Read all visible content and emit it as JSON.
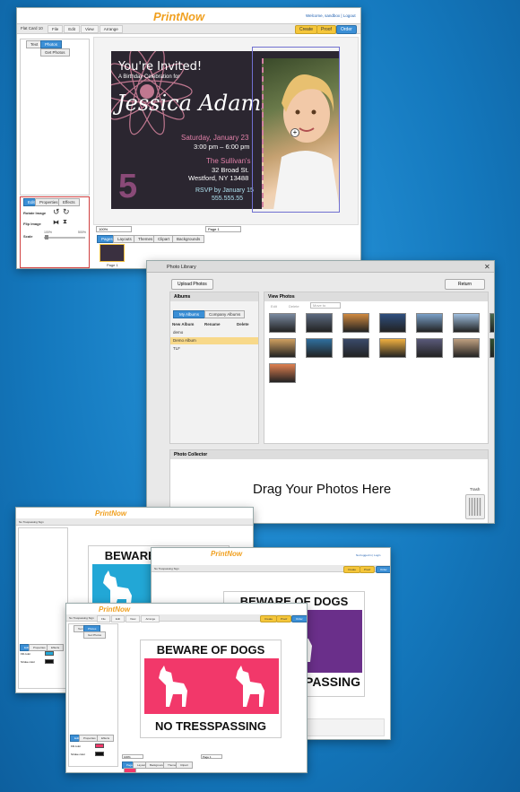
{
  "editor1": {
    "logo": "PrintNow",
    "welcome": "Welcome, sandbox | Logout",
    "doc_name": "Flat Card 10",
    "menu": [
      "File",
      "Edit",
      "View",
      "Arrange"
    ],
    "create": "Create",
    "proof": "Proof",
    "order": "Order",
    "tabs": [
      "Text",
      "Photos"
    ],
    "get_photos": "Get Photos",
    "card": {
      "invited": "You're Invited!",
      "subtitle": "A Birthday Celebration for",
      "name": "Jessica Adams",
      "date": "Saturday, January 23",
      "time": "3:00 pm – 6:00 pm",
      "venue": "The Sullivan's",
      "street": "32 Broad St.",
      "city": "Westford, NY 13488",
      "rsvp": "RSVP by January 15",
      "phone": "555.555.55",
      "number": "5"
    },
    "panel_tabs": [
      "Edit",
      "Properties",
      "Effects"
    ],
    "rotate": "Rotate Image",
    "flip": "Flip Image",
    "scale": "Scale",
    "scale_min": "100%",
    "scale_max": "500%",
    "zoom": "100%",
    "page": "Page 1",
    "bottom_tabs": [
      "Pages",
      "Layouts",
      "Themes",
      "Clipart",
      "Backgrounds"
    ],
    "page_label": "Page 1"
  },
  "library": {
    "title": "Photo Library",
    "upload": "Upload Photos",
    "return": "Return",
    "albums": "Albums",
    "my_albums": "My Albums",
    "company_albums": "Company Albums",
    "new_album": "New Album",
    "rename": "Rename",
    "delete": "Delete",
    "album_items": [
      "demo",
      "Demo Album",
      "TLF"
    ],
    "view_photos": "View Photos",
    "photo_actions": [
      "Edit",
      "Delete",
      "Move to"
    ],
    "collector": "Photo Collector",
    "drag": "Drag Your Photos Here",
    "trash": "Trash",
    "thumb_colors": [
      "#7a8aa0",
      "#5c6a80",
      "#d08a40",
      "#2f4f7f",
      "#7aa0c8",
      "#a0c0e0",
      "#4a6a50",
      "#d0a060",
      "#2f6f9f",
      "#3a4a6a",
      "#f0b040",
      "#5a5a7a",
      "#c0a080",
      "#305030",
      "#e08050"
    ]
  },
  "signs": {
    "logo": "PrintNow",
    "doc_name": "No Trespassing Sign",
    "menu": [
      "File",
      "Edit",
      "View",
      "Arrange"
    ],
    "tabs": [
      "Text",
      "Photos"
    ],
    "get_photos": "Get Photos",
    "create": "Create",
    "proof": "Proof",
    "order": "Order",
    "logged_in": "Not logged in | Login",
    "beware": "BEWARE OF DOGS",
    "no_tress": "NO TRESSPASSING",
    "tress_frag": "SPASSING",
    "panel_tabs": [
      "Edit",
      "Properties",
      "Effects"
    ],
    "fill_color": "Fill color",
    "stroke_color": "Stroke color",
    "zoom": "100%",
    "page": "Page 1",
    "bottom_tabs": [
      "Pages",
      "Layouts",
      "Backgrounds",
      "Themes",
      "Clipart"
    ],
    "colors": {
      "cyan": "#22a7d6",
      "purple": "#6a2f8a",
      "pink": "#f2386a"
    }
  }
}
